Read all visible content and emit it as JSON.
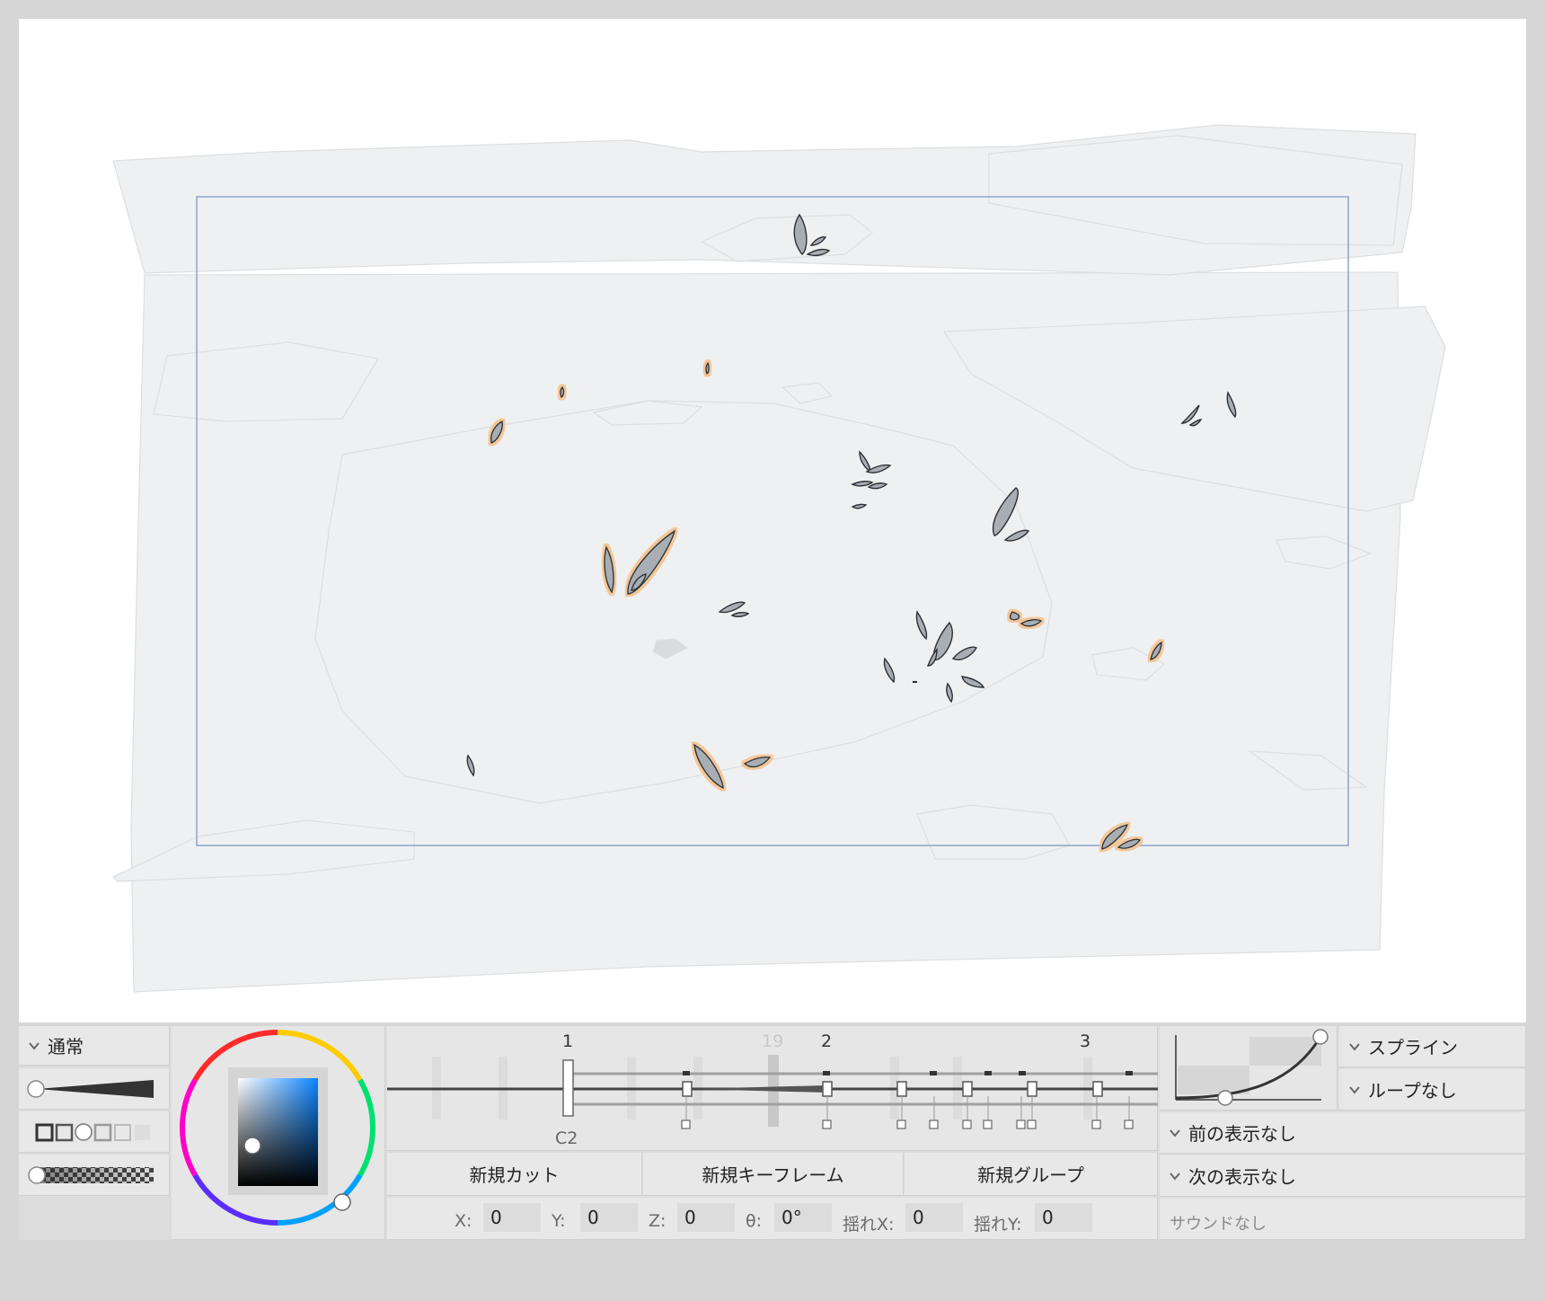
{
  "canvas": {
    "bg": "#ffffff",
    "layer_fill": "#eff0f1",
    "layer_stroke": "#dadcde",
    "frame_stroke": "#8aa0c8",
    "leaf_fill": "#a9aeb4",
    "leaf_stroke": "#2c3036",
    "leaf_glow": "#f3c79a"
  },
  "brush_panel": {
    "blend_mode": "通常",
    "icons": [
      "chevron-down-icon",
      "brush-size-slider",
      "brush-shape-presets",
      "opacity-slider"
    ]
  },
  "color_picker": {
    "ring": "hue-ring",
    "selected_color": "#1a5fb4"
  },
  "timeline": {
    "keyframe_labels": [
      "1",
      "19",
      "2",
      "3"
    ],
    "current_cut": "C2"
  },
  "actions": {
    "new_cut": "新規カット",
    "new_keyframe": "新規キーフレーム",
    "new_group": "新規グループ"
  },
  "transform": {
    "x_label": "X:",
    "x_value": "0",
    "y_label": "Y:",
    "y_value": "0",
    "z_label": "Z:",
    "z_value": "0",
    "theta_label": "θ:",
    "theta_value": "0°",
    "shake_x_label": "揺れX:",
    "shake_x_value": "0",
    "shake_y_label": "揺れY:",
    "shake_y_value": "0"
  },
  "curve": {
    "interpolation": "スプライン",
    "loop": "ループなし",
    "onion_prev": "前の表示なし",
    "onion_next": "次の表示なし",
    "sound": "サウンドなし"
  }
}
